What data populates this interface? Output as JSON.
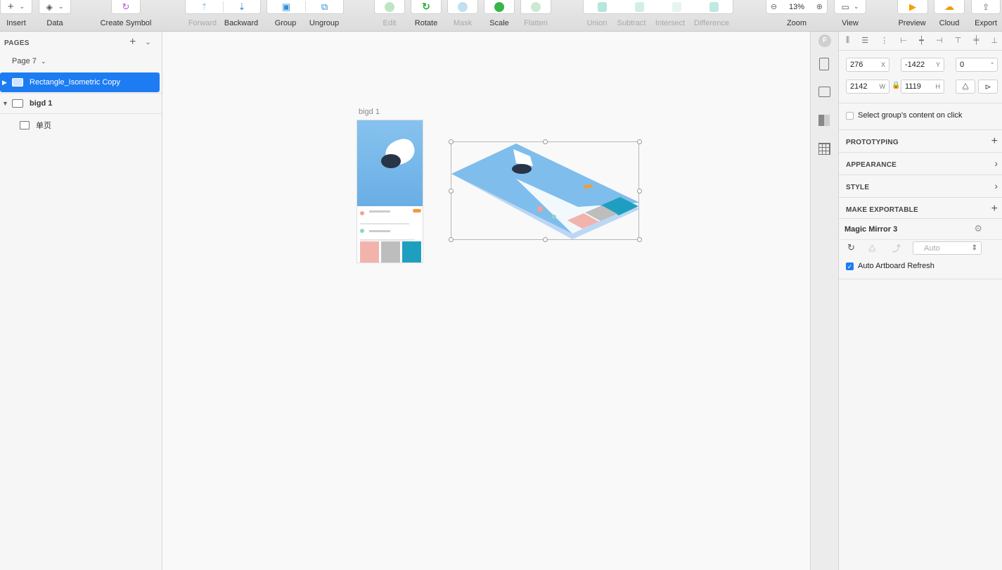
{
  "toolbar": {
    "insert": "Insert",
    "data": "Data",
    "create_symbol": "Create Symbol",
    "forward": "Forward",
    "backward": "Backward",
    "group": "Group",
    "ungroup": "Ungroup",
    "edit": "Edit",
    "rotate": "Rotate",
    "mask": "Mask",
    "scale": "Scale",
    "flatten": "Flatten",
    "union": "Union",
    "subtract": "Subtract",
    "intersect": "Intersect",
    "difference": "Difference",
    "zoom_value": "13%",
    "zoom": "Zoom",
    "view": "View",
    "preview": "Preview",
    "cloud": "Cloud",
    "export": "Export"
  },
  "sidebar": {
    "pages_header": "PAGES",
    "current_page": "Page 7",
    "layers": [
      {
        "label": "Rectangle_Isometric Copy",
        "selected": true
      },
      {
        "label": "bigd 1",
        "selected": false
      },
      {
        "label": "单页",
        "selected": false
      }
    ]
  },
  "canvas": {
    "artboard_name": "bigd 1"
  },
  "inspector": {
    "x": "276",
    "x_suffix": "X",
    "y": "-1422",
    "y_suffix": "Y",
    "rotation": "0",
    "rotation_suffix": "°",
    "w": "2142",
    "w_suffix": "W",
    "h": "1119",
    "h_suffix": "H",
    "select_group_label": "Select group’s content on click",
    "sections": {
      "prototyping": "PROTOTYPING",
      "appearance": "APPEARANCE",
      "style": "STYLE",
      "make_exportable": "MAKE EXPORTABLE"
    },
    "plugin_title": "Magic Mirror 3",
    "quality_value": "Auto",
    "auto_refresh_label": "Auto Artboard Refresh"
  },
  "colors": {
    "accent": "#1d7cf2",
    "sky": "#86c2ee"
  }
}
